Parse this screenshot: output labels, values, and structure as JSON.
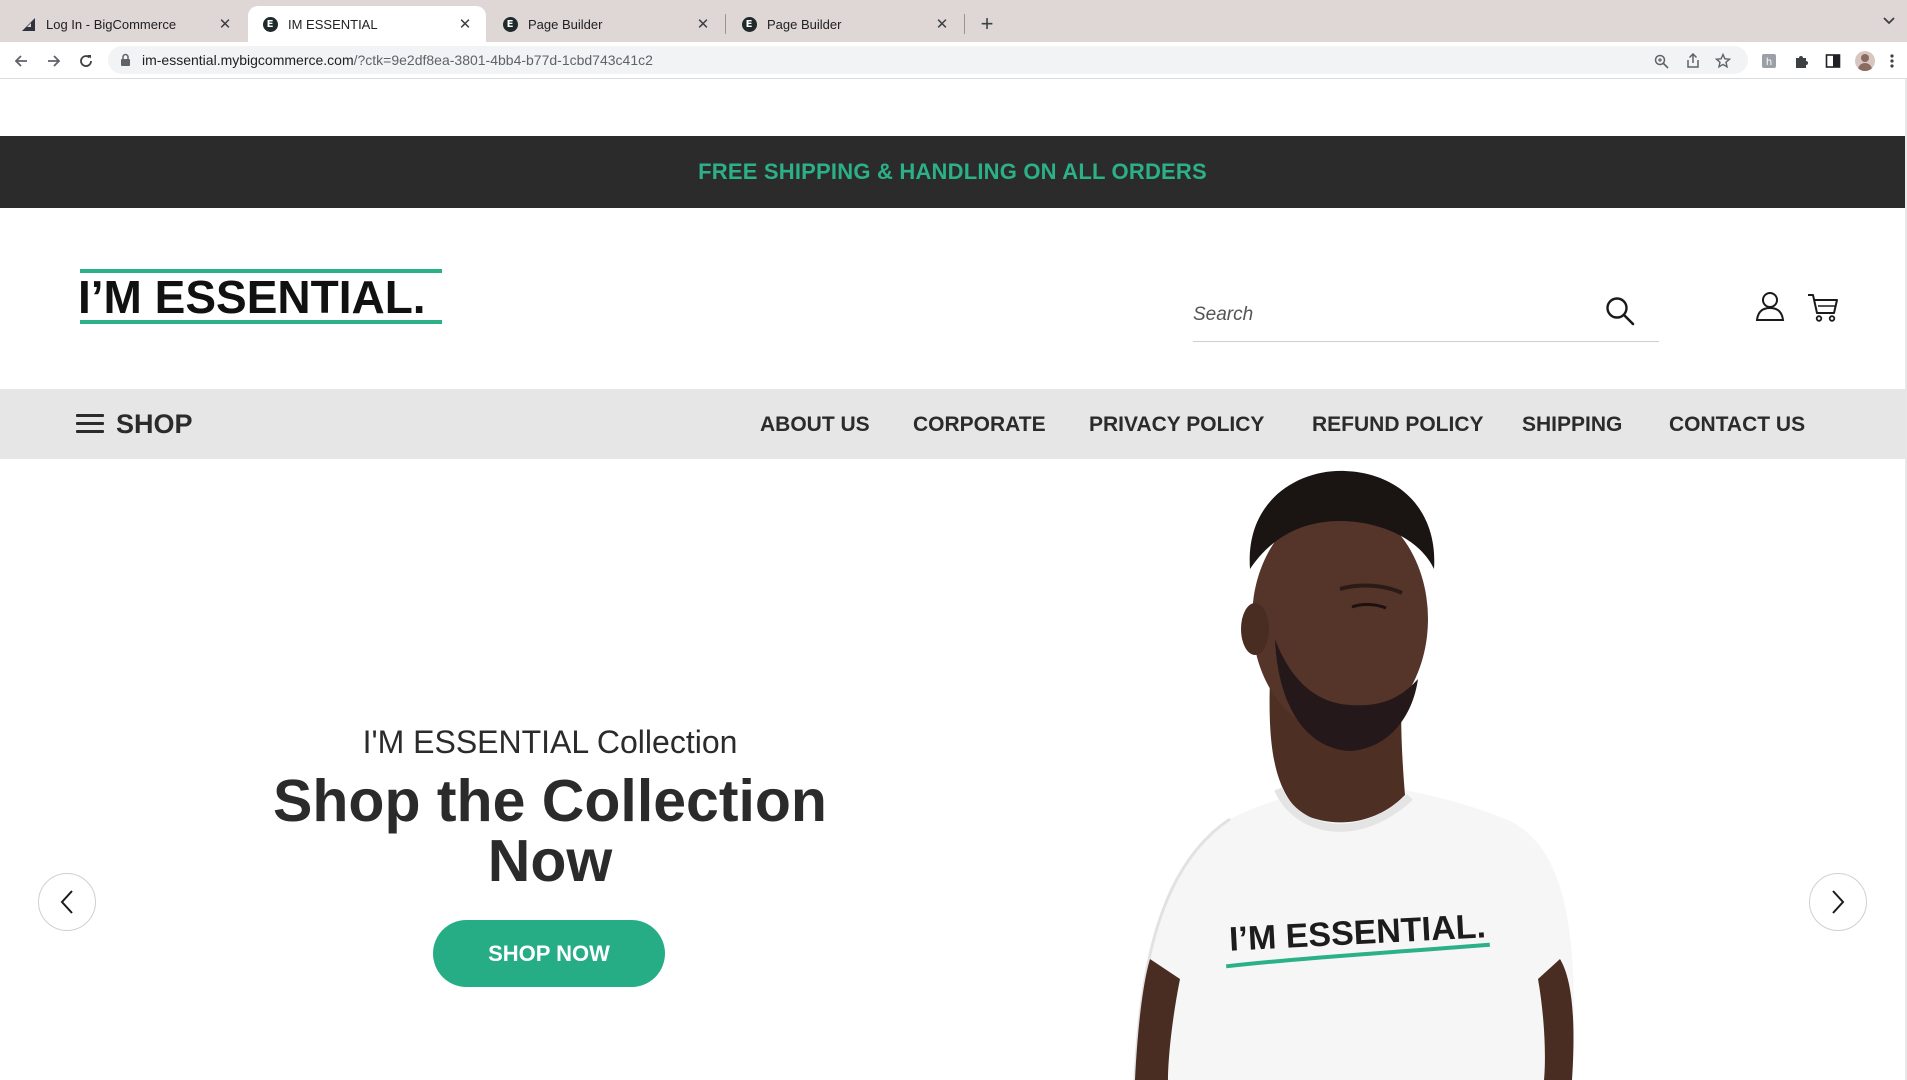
{
  "browser": {
    "tabs": [
      {
        "title": "Log In - BigCommerce",
        "icon": "bigcommerce-icon"
      },
      {
        "title": "IM ESSENTIAL",
        "icon": "e-icon"
      },
      {
        "title": "Page Builder",
        "icon": "e-icon"
      },
      {
        "title": "Page Builder",
        "icon": "e-icon"
      }
    ],
    "url_host": "im-essential.mybigcommerce.com",
    "url_path": "/?ctk=9e2df8ea-3801-4bb4-b77d-1cbd743c41c2"
  },
  "announcement": "FREE SHIPPING & HANDLING ON ALL ORDERS",
  "logo_text": "I’M ESSENTIAL.",
  "search": {
    "placeholder": "Search"
  },
  "nav": {
    "shop_label": "SHOP",
    "links": [
      "ABOUT US",
      "CORPORATE",
      "PRIVACY POLICY",
      "REFUND POLICY",
      "SHIPPING",
      "CONTACT US"
    ]
  },
  "hero": {
    "pretitle": "I'M ESSENTIAL Collection",
    "headline_line1": "Shop the Collection",
    "headline_line2": "Now",
    "cta": "SHOP NOW",
    "shirt_print": "I’M ESSENTIAL."
  },
  "colors": {
    "brand_green": "#2bb087",
    "announcement_bg": "#2b2b2b",
    "nav_bg": "#e6e6e6",
    "text_dark": "#2b2b2b"
  }
}
